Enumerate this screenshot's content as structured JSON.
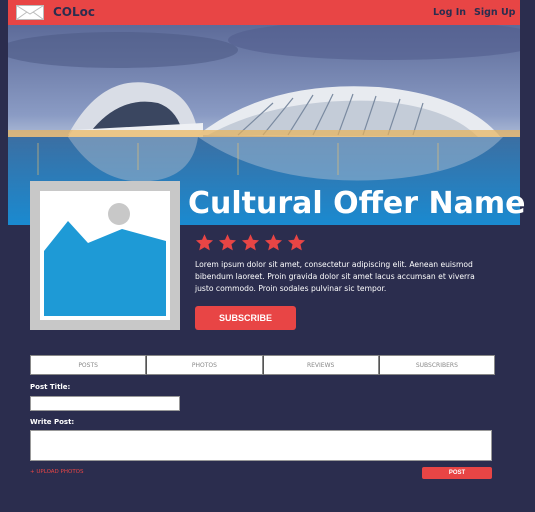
{
  "nav": {
    "brand": "COLoc",
    "login": "Log In",
    "signup": "Sign Up",
    "accent_color": "#e84545"
  },
  "offer": {
    "name": "Cultural Offer Name",
    "rating": 5,
    "rating_max": 5,
    "description": "Lorem ipsum dolor sit amet, consectetur adipiscing elit. Aenean euismod bibendum laoreet. Proin gravida dolor sit amet lacus accumsan et viverra justo commodo. Proin sodales pulvinar sic tempor.",
    "subscribe_label": "SUBSCRIBE"
  },
  "tabs": [
    {
      "label": "POSTS"
    },
    {
      "label": "PHOTOS"
    },
    {
      "label": "REVIEWS"
    },
    {
      "label": "SUBSCRIBERS"
    }
  ],
  "post_form": {
    "title_label": "Post Title:",
    "title_value": "",
    "body_label": "Write Post:",
    "body_value": "",
    "upload_label": "+ UPLOAD PHOTOS",
    "post_label": "POST"
  },
  "icons": {
    "logo": "envelope-icon",
    "image_placeholder": "image-placeholder-icon",
    "rating": "star-icon"
  },
  "colors": {
    "background": "#2b2d4e",
    "accent": "#e84545",
    "placeholder_blue": "#1e9ad6"
  }
}
